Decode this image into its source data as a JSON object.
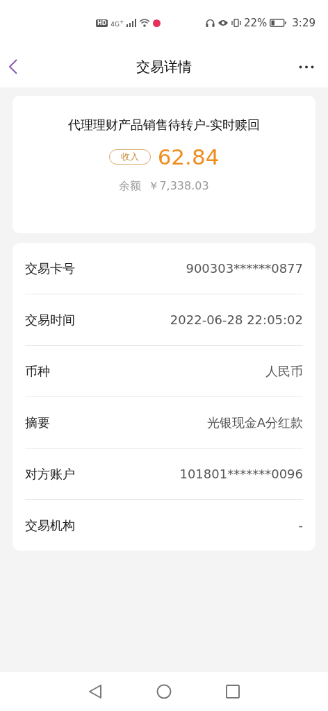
{
  "status_bar": {
    "hd": "HD",
    "network": "4G$^{+}$",
    "battery_percent": "22%",
    "time": "3:29"
  },
  "header": {
    "title": "交易详情"
  },
  "summary": {
    "title": "代理理财产品销售待转户-实时赎回",
    "tag": "收入",
    "amount": "62.84",
    "balance_label": "余额",
    "balance": "￥7,338.03"
  },
  "details": [
    {
      "label": "交易卡号",
      "value": "900303******0877"
    },
    {
      "label": "交易时间",
      "value": "2022-06-28 22:05:02"
    },
    {
      "label": "币种",
      "value": "人民币"
    },
    {
      "label": "摘要",
      "value": "光银现金A分红款"
    },
    {
      "label": "对方账户",
      "value": "101801*******0096"
    },
    {
      "label": "交易机构",
      "value": "-"
    }
  ]
}
